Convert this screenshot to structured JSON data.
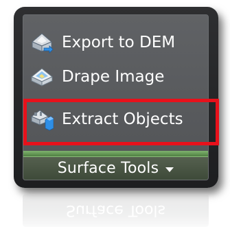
{
  "toolbar": {
    "tools": [
      {
        "label": "Export to DEM",
        "icon": "export-dem-icon"
      },
      {
        "label": "Drape Image",
        "icon": "drape-image-icon"
      },
      {
        "label": "Extract Objects",
        "icon": "extract-objects-icon"
      }
    ],
    "panel_title": "Surface Tools",
    "highlight_color": "#e8111b"
  }
}
